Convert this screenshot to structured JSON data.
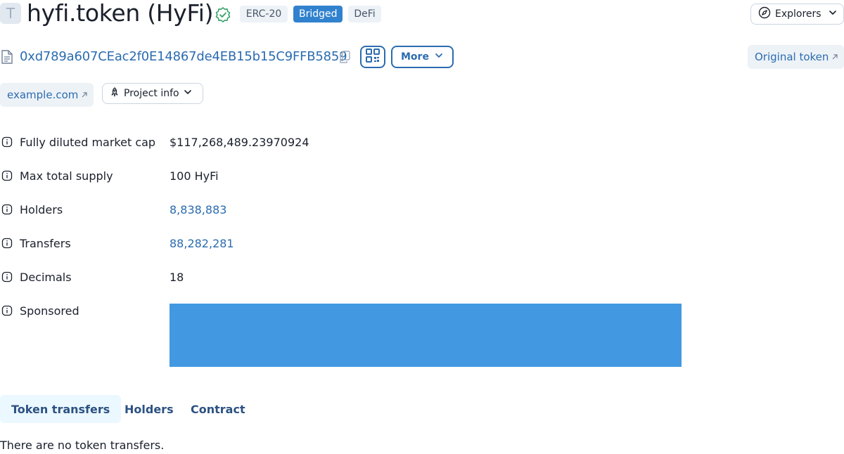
{
  "header": {
    "avatar_letter": "T",
    "title": "hyfi.token (HyFi)",
    "tags": [
      "ERC-20",
      "Bridged",
      "DeFi"
    ],
    "explorers_label": "Explorers"
  },
  "address_row": {
    "address": "0xd789a607CEac2f0E14867de4EB15b15C9FFB5859",
    "more_label": "More",
    "original_token_label": "Original token"
  },
  "links": {
    "site_label": "example.com",
    "project_info_label": "Project info"
  },
  "details": [
    {
      "label": "Fully diluted market cap",
      "value": "$117,268,489.23970924"
    },
    {
      "label": "Max total supply",
      "value": "100 HyFi"
    },
    {
      "label": "Holders",
      "value": "8,838,883"
    },
    {
      "label": "Transfers",
      "value": "88,282,281"
    },
    {
      "label": "Decimals",
      "value": "18"
    },
    {
      "label": "Sponsored",
      "value": ""
    }
  ],
  "colors": {
    "accent": "#2b6cb0",
    "verified": "#38a169",
    "sponsored_banner": "#4299e1",
    "tag_bridged": "#3182ce"
  },
  "tabs": [
    {
      "label": "Token transfers",
      "active": true
    },
    {
      "label": "Holders",
      "active": false
    },
    {
      "label": "Contract",
      "active": false
    }
  ],
  "empty_message": "There are no token transfers."
}
